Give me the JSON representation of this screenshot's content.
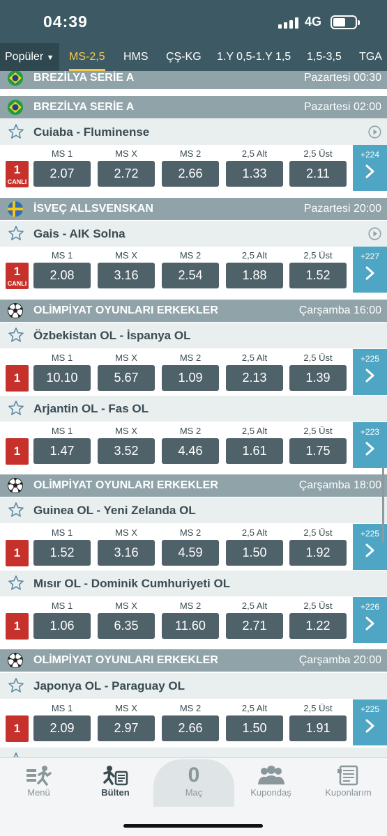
{
  "status_bar": {
    "time": "04:39",
    "network": "4G",
    "battery_level": 0.55
  },
  "tabs": {
    "first": "Popüler",
    "items": [
      "MS-2,5",
      "HMS",
      "ÇŞ-KG",
      "1.Y 0,5-1.Y 1,5",
      "1,5-3,5",
      "TGA"
    ],
    "active_index": 0
  },
  "odds_labels": [
    "MS 1",
    "MS X",
    "MS 2",
    "2,5 Alt",
    "2,5 Üst"
  ],
  "live_label": "CANLI",
  "leagues": [
    {
      "name": "BREZİLYA SERİE A",
      "date": "Pazartesi 00:30",
      "icon": "brazil-flag-icon"
    },
    {
      "name": "BREZİLYA SERİE A",
      "date": "Pazartesi 02:00",
      "icon": "brazil-flag-icon"
    },
    {
      "name": "İSVEÇ ALLSVENSKAN",
      "date": "Pazartesi 20:00",
      "icon": "sweden-flag-icon"
    },
    {
      "name": "OLİMPİYAT OYUNLARI ERKEKLER",
      "date": "Çarşamba 16:00",
      "icon": "soccer-ball-icon"
    },
    {
      "name": "OLİMPİYAT OYUNLARI ERKEKLER",
      "date": "Çarşamba 18:00",
      "icon": "soccer-ball-icon"
    },
    {
      "name": "OLİMPİYAT OYUNLARI ERKEKLER",
      "date": "Çarşamba 20:00",
      "icon": "soccer-ball-icon"
    }
  ],
  "matches": [
    {
      "name": "Cuiaba - Fluminense",
      "badge": "1",
      "live": true,
      "odds": [
        "2.07",
        "2.72",
        "2.66",
        "1.33",
        "2.11"
      ],
      "more": "+224"
    },
    {
      "name": "Gais - AIK Solna",
      "badge": "1",
      "live": true,
      "odds": [
        "2.08",
        "3.16",
        "2.54",
        "1.88",
        "1.52"
      ],
      "more": "+227"
    },
    {
      "name": "Özbekistan OL - İspanya OL",
      "badge": "1",
      "live": false,
      "odds": [
        "10.10",
        "5.67",
        "1.09",
        "2.13",
        "1.39"
      ],
      "more": "+225"
    },
    {
      "name": "Arjantin OL - Fas OL",
      "badge": "1",
      "live": false,
      "odds": [
        "1.47",
        "3.52",
        "4.46",
        "1.61",
        "1.75"
      ],
      "more": "+223"
    },
    {
      "name": "Guinea OL - Yeni Zelanda OL",
      "badge": "1",
      "live": false,
      "odds": [
        "1.52",
        "3.16",
        "4.59",
        "1.50",
        "1.92"
      ],
      "more": "+225"
    },
    {
      "name": "Mısır OL - Dominik Cumhuriyeti OL",
      "badge": "1",
      "live": false,
      "odds": [
        "1.06",
        "6.35",
        "11.60",
        "2.71",
        "1.22"
      ],
      "more": "+226"
    },
    {
      "name": "Japonya OL - Paraguay OL",
      "badge": "1",
      "live": false,
      "odds": [
        "2.09",
        "2.97",
        "2.66",
        "1.50",
        "1.91"
      ],
      "more": "+225"
    }
  ],
  "bottom_nav": {
    "menu": "Menü",
    "bulten": "Bülten",
    "count": "0",
    "mac": "Maç",
    "kupondas": "Kupondaş",
    "kuponlarim": "Kuponlarım"
  }
}
